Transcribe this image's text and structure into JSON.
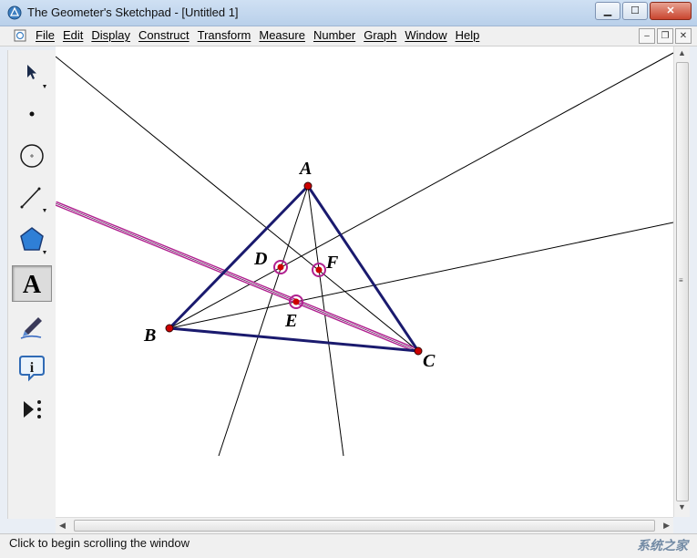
{
  "window": {
    "title": "The Geometer's Sketchpad - [Untitled 1]"
  },
  "menu": {
    "items": [
      {
        "label": "File"
      },
      {
        "label": "Edit"
      },
      {
        "label": "Display"
      },
      {
        "label": "Construct"
      },
      {
        "label": "Transform"
      },
      {
        "label": "Measure"
      },
      {
        "label": "Number"
      },
      {
        "label": "Graph"
      },
      {
        "label": "Window"
      },
      {
        "label": "Help"
      }
    ]
  },
  "toolbox": {
    "tools": [
      {
        "name": "arrow-select-tool",
        "icon": "arrow-pointer-icon",
        "active": false
      },
      {
        "name": "point-tool",
        "icon": "point-icon",
        "active": false
      },
      {
        "name": "compass-tool",
        "icon": "circle-icon",
        "active": false
      },
      {
        "name": "straightedge-tool",
        "icon": "segment-icon",
        "active": false
      },
      {
        "name": "polygon-tool",
        "icon": "pentagon-icon",
        "active": false
      },
      {
        "name": "text-tool",
        "icon": "text-a-icon",
        "active": true
      },
      {
        "name": "marker-tool",
        "icon": "marker-pen-icon",
        "active": false
      },
      {
        "name": "information-tool",
        "icon": "info-icon",
        "active": false
      },
      {
        "name": "custom-tool",
        "icon": "play-more-icon",
        "active": false
      }
    ]
  },
  "sketch": {
    "points": [
      {
        "id": "A",
        "label": "A"
      },
      {
        "id": "B",
        "label": "B"
      },
      {
        "id": "C",
        "label": "C"
      },
      {
        "id": "D",
        "label": "D"
      },
      {
        "id": "E",
        "label": "E"
      },
      {
        "id": "F",
        "label": "F"
      }
    ],
    "colors": {
      "triangle": "#1a1a6e",
      "point": "#cc0000",
      "highlight": "#b0208f",
      "line": "#000000"
    }
  },
  "status": {
    "text": "Click to begin scrolling the window",
    "watermark": "系统之家"
  }
}
